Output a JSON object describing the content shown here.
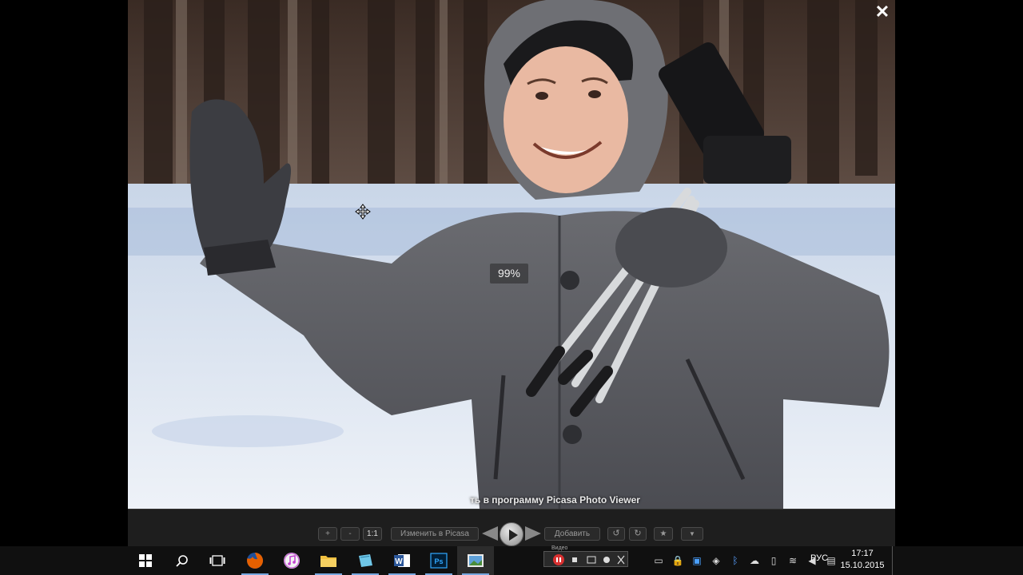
{
  "viewer": {
    "zoom_level": "99%",
    "caption": "ть в программу Picasa Photo Viewer",
    "close_symbol": "✕",
    "toolbar": {
      "zoom_in": "+",
      "zoom_out": "-",
      "actual_size": "1:1",
      "edit_in_picasa": "Изменить в Picasa",
      "add": "Добавить",
      "rotate_left_icon": "↺",
      "rotate_right_icon": "↻",
      "star_icon": "★",
      "more_icon": "▼"
    }
  },
  "taskbar": {
    "apps": [
      {
        "name": "start",
        "icon": "windows-icon"
      },
      {
        "name": "search",
        "icon": "search-icon"
      },
      {
        "name": "task-view",
        "icon": "task-view-icon"
      },
      {
        "name": "firefox",
        "icon": "firefox-icon"
      },
      {
        "name": "itunes",
        "icon": "itunes-icon"
      },
      {
        "name": "explorer",
        "icon": "folder-icon"
      },
      {
        "name": "notepad",
        "icon": "notepad-icon"
      },
      {
        "name": "word",
        "icon": "word-icon",
        "label": "W"
      },
      {
        "name": "photoshop",
        "icon": "photoshop-icon",
        "label": "Ps"
      },
      {
        "name": "picasa",
        "icon": "picasa-icon"
      }
    ],
    "recorder_label": "Видео",
    "language": "РУС",
    "time": "17:17",
    "date": "15.10.2015"
  },
  "colors": {
    "taskbar_bg": "#101010",
    "viewer_bar_bg": "#1e1e1e",
    "accent": "#78a8e0",
    "word": "#2b579a",
    "photoshop": "#001e36",
    "firefox": "#e66000"
  }
}
